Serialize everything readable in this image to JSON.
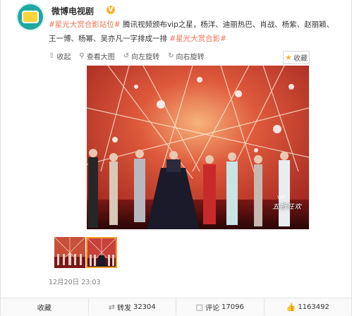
{
  "header": {
    "nickname": "微博电视剧",
    "verified_color": "#f8b43a",
    "avatar_text": "微博\n电视剧"
  },
  "post": {
    "segments": [
      {
        "text": "#星光大赏合影站位#",
        "type": "tag"
      },
      {
        "text": " 腾讯视频颁布vip之星，杨洋、迪丽热巴、肖战、杨紫、赵丽颖、王一博、杨幂、吴亦凡一字排成一排 ",
        "type": "text"
      },
      {
        "text": "#星光大赏合影#",
        "type": "tag"
      }
    ]
  },
  "media_toolbar": {
    "collapse": "收起",
    "view_large": "查看大图",
    "rotate_left": "向左旋转",
    "rotate_right": "向右旋转",
    "collect": "收藏"
  },
  "image": {
    "overlay_vip": "VIP",
    "overlay_text": "五折狂欢"
  },
  "timestamp": "12月20日 23:03",
  "footer": {
    "collect": "收藏",
    "repost_label": "转发",
    "repost_count": "32304",
    "comment_label": "评论",
    "comment_count": "17096",
    "like_count": "1163492"
  },
  "colors": {
    "tag": "#eb7350",
    "thumb_selected": "#f19e28"
  }
}
